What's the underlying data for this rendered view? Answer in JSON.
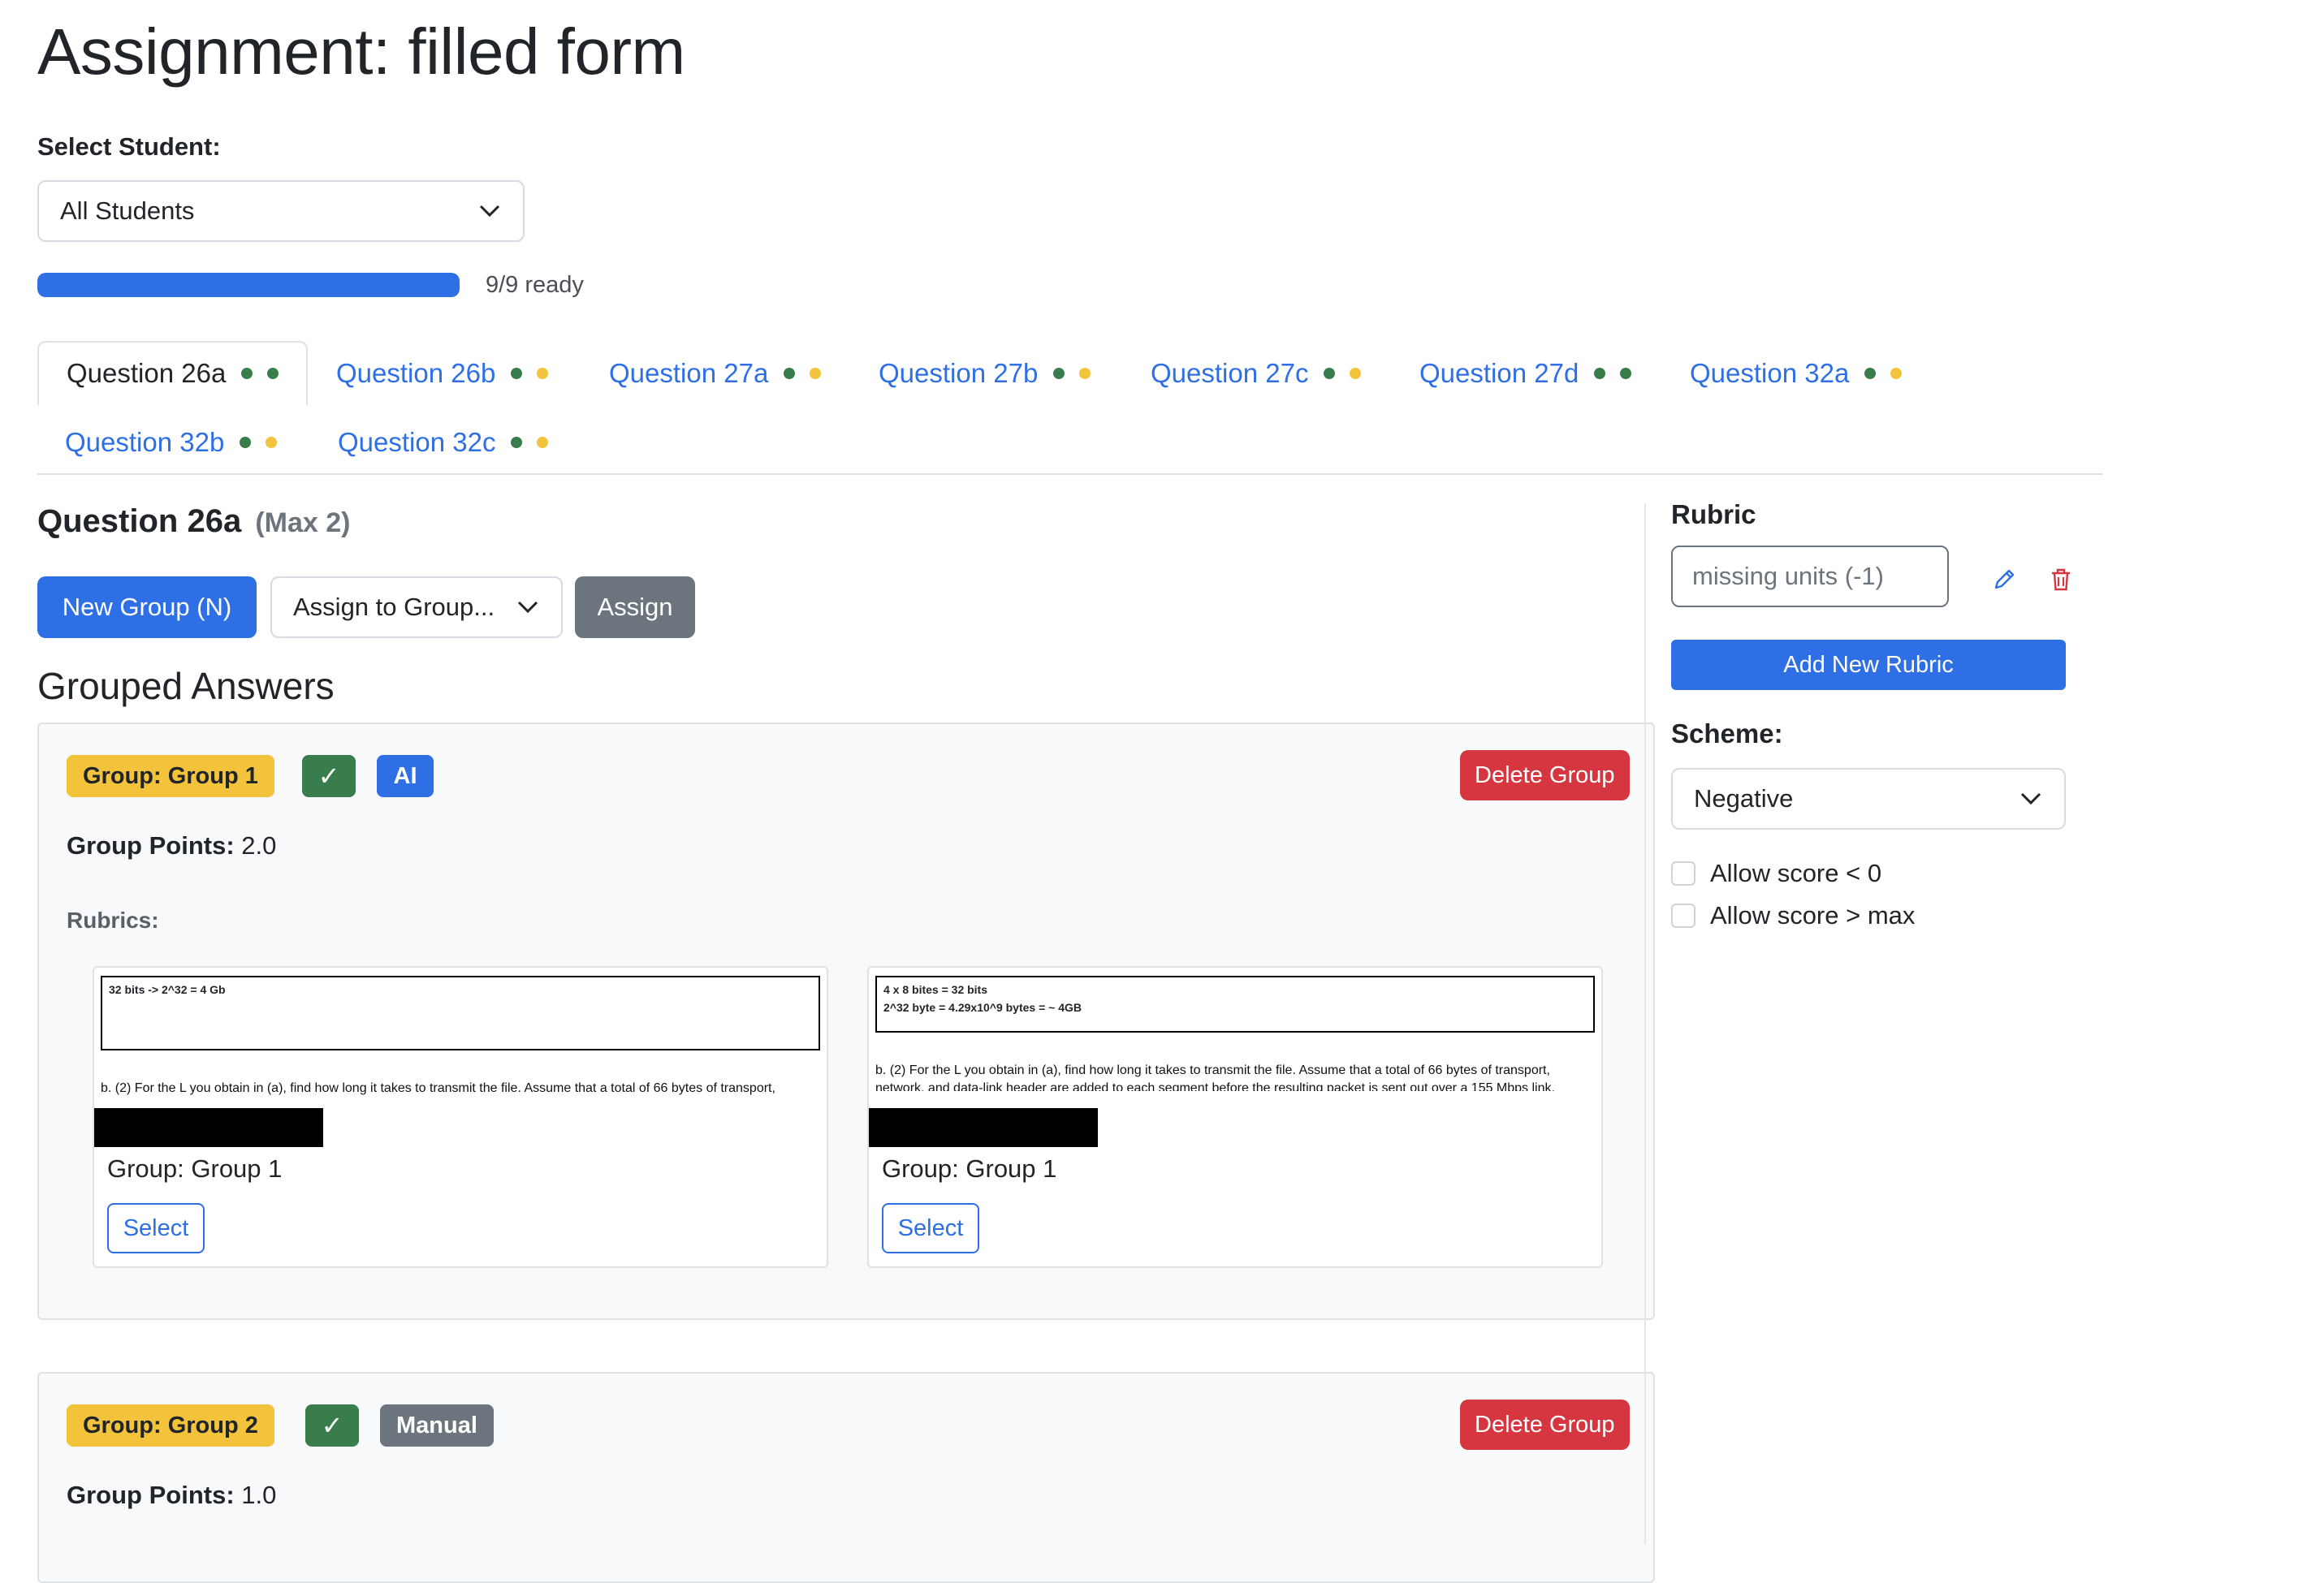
{
  "page": {
    "title": "Assignment: filled form"
  },
  "student": {
    "label": "Select Student:",
    "selected": "All Students"
  },
  "progress": {
    "fraction": 1.0,
    "text": "9/9 ready"
  },
  "tabs": [
    {
      "label": "Question 26a",
      "active": true,
      "dots": [
        "green",
        "green"
      ]
    },
    {
      "label": "Question 26b",
      "active": false,
      "dots": [
        "green",
        "yellow"
      ]
    },
    {
      "label": "Question 27a",
      "active": false,
      "dots": [
        "green",
        "yellow"
      ]
    },
    {
      "label": "Question 27b",
      "active": false,
      "dots": [
        "green",
        "yellow"
      ]
    },
    {
      "label": "Question 27c",
      "active": false,
      "dots": [
        "green",
        "yellow"
      ]
    },
    {
      "label": "Question 27d",
      "active": false,
      "dots": [
        "green",
        "green"
      ]
    },
    {
      "label": "Question 32a",
      "active": false,
      "dots": [
        "green",
        "yellow"
      ]
    },
    {
      "label": "Question 32b",
      "active": false,
      "dots": [
        "green",
        "yellow"
      ]
    },
    {
      "label": "Question 32c",
      "active": false,
      "dots": [
        "green",
        "yellow"
      ]
    }
  ],
  "question": {
    "title": "Question 26a",
    "max": "(Max 2)"
  },
  "toolbar": {
    "new_group": "New Group (N)",
    "assign_select": "Assign to Group...",
    "assign": "Assign"
  },
  "grouped_heading": "Grouped Answers",
  "groups": [
    {
      "badge": "Group: Group 1",
      "check": "✓",
      "source": "AI",
      "delete": "Delete Group",
      "points_label": "Group Points:",
      "points": "2.0",
      "rubrics_label": "Rubrics:",
      "answers": [
        {
          "scan_box": "32 bits -> 2^32 = 4 Gb",
          "scan_text": "b. (2) For the L you obtain in (a), find how long it takes to transmit the file. Assume that a total of 66 bytes of transport,",
          "scan_text2": "",
          "group": "Group: Group 1",
          "select": "Select"
        },
        {
          "scan_box": "4 x 8 bites = 32 bits\n2^32 byte = 4.29x10^9 bytes = ~ 4GB",
          "scan_text": "b. (2) For the L you obtain in (a), find how long it takes to transmit the file. Assume that a total of 66 bytes of transport,",
          "scan_text2": "network, and data-link header are added to each segment before the resulting packet is sent out over a 155 Mbps link.",
          "group": "Group: Group 1",
          "select": "Select"
        }
      ]
    },
    {
      "badge": "Group: Group 2",
      "check": "✓",
      "source": "Manual",
      "delete": "Delete Group",
      "points_label": "Group Points:",
      "points": "1.0"
    }
  ],
  "sidebar": {
    "rubric_label": "Rubric",
    "rubric_value": "missing units (-1)",
    "add_rubric": "Add New Rubric",
    "scheme_label": "Scheme:",
    "scheme_value": "Negative",
    "allow_below_zero": "Allow score < 0",
    "allow_above_max": "Allow score > max"
  },
  "colors": {
    "primary": "#2f6fe6",
    "danger": "#d6363f",
    "success": "#3a7d4c",
    "warning": "#f3c33c",
    "secondary": "#6c757d"
  },
  "icons": {
    "edit": "pencil-icon",
    "delete": "trash-icon",
    "dropdown": "chevron-down-icon"
  }
}
